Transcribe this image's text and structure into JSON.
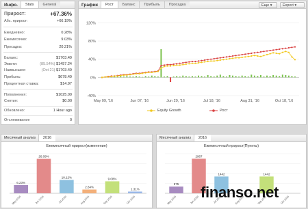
{
  "info": {
    "title": "Инфо.",
    "tabs": [
      "Stats",
      "General"
    ],
    "rows": [
      {
        "label": "Прирост:",
        "value": "+67.36%"
      },
      {
        "label": "Абс. прирост:",
        "value": "+66.19%"
      },
      {
        "label": "Ежедневно:",
        "value": "0.28%"
      },
      {
        "label": "Ежемесячно:",
        "value": "9.03%"
      },
      {
        "label": "Просадка:",
        "value": "20.21%"
      },
      {
        "label": "Баланс:",
        "value": "$1703.49"
      },
      {
        "label": "Эквити:",
        "value": "$1457.24",
        "note": "(85.54%)"
      },
      {
        "label": "Наивысшее:",
        "value": "$1703.49",
        "note": "(Oct 21)"
      },
      {
        "label": "Прибыль:",
        "value": "$678.49"
      },
      {
        "label": "Процентная ставка:",
        "value": "$14.97"
      },
      {
        "label": "Пополнения:",
        "value": "$1025.00"
      },
      {
        "label": "Снятия:",
        "value": "$0.00"
      },
      {
        "label": "Обновлено:",
        "value": "1 Hour ago"
      },
      {
        "label": "Отслеживание",
        "value": "0"
      }
    ]
  },
  "graph": {
    "title": "График",
    "tabs": [
      "Рост",
      "Баланс",
      "Прибыль",
      "Просадка"
    ],
    "dropdown": "Еще",
    "export": "Export",
    "yticks": [
      "120%",
      "80%",
      "40%",
      "0%",
      "-40%"
    ],
    "xticks": [
      "May 09, '16",
      "Jun 07, '16",
      "Jun 29, '16",
      "Jul 18, '16",
      "Aug 31, '16",
      "Oct 18, '16"
    ],
    "legend": [
      "Equity Growth",
      "Рост"
    ],
    "colors": {
      "growth": "#d94040",
      "equity": "#f2c81e",
      "bar_pos": "#7cc24f",
      "bar_neg": "#e04040"
    }
  },
  "chart_data": [
    {
      "type": "line",
      "ylim": [
        -40,
        140
      ],
      "series": [
        {
          "name": "Рост",
          "values": [
            0,
            1,
            2,
            3,
            3,
            4,
            5,
            6,
            6,
            7,
            8,
            9,
            9,
            10,
            11,
            12,
            12,
            13,
            14,
            26,
            27,
            28,
            28,
            29,
            30,
            31,
            32,
            33,
            34,
            35,
            35,
            36,
            37,
            38,
            39,
            40,
            41,
            42,
            43,
            44,
            45,
            46,
            47,
            48,
            49,
            50,
            51,
            52,
            53,
            54,
            55,
            56,
            57,
            58,
            59,
            60,
            61,
            62,
            63,
            64,
            65,
            66,
            67
          ]
        },
        {
          "name": "Equity Growth",
          "values": [
            0,
            1,
            1,
            2,
            3,
            3,
            4,
            5,
            5,
            6,
            7,
            8,
            8,
            9,
            10,
            11,
            11,
            12,
            13,
            20,
            24,
            25,
            25,
            26,
            27,
            27,
            28,
            29,
            30,
            31,
            31,
            32,
            33,
            34,
            35,
            36,
            36,
            37,
            38,
            39,
            40,
            41,
            42,
            43,
            43,
            44,
            45,
            46,
            47,
            48,
            47,
            46,
            48,
            50,
            52,
            54,
            53,
            52,
            55,
            57,
            55,
            45,
            39
          ]
        }
      ],
      "bars": [
        1,
        2,
        1,
        3,
        2,
        2,
        4,
        2,
        3,
        2,
        2,
        3,
        2,
        1,
        3,
        2,
        4,
        3,
        2,
        62,
        2,
        3,
        -10,
        2,
        3,
        2,
        4,
        3,
        2,
        3,
        2,
        4,
        3,
        2,
        5,
        3,
        2,
        4,
        6,
        3,
        2,
        5,
        4,
        3,
        2,
        4,
        3,
        2,
        6,
        4,
        3,
        5,
        2,
        4,
        3,
        5,
        4,
        3,
        6,
        5,
        4,
        3,
        2
      ]
    },
    {
      "type": "bar",
      "title": "Ежемесячный прирост(изменение)",
      "categories": [
        "May 2016",
        "Jun 2016",
        "Jul 2016",
        "Aug 2016",
        "Sep 2016",
        "Oct 2016"
      ],
      "values": [
        6.23,
        26.09,
        10.12,
        2.84,
        9.08,
        1.31
      ],
      "labels": [
        "6.23%",
        "26.09%",
        "10.12%",
        "2.84%",
        "9.08%",
        "1.31%"
      ],
      "colors": [
        "#a78bc0",
        "#e38a8a",
        "#8ec1e0",
        "#f3b07a",
        "#c3e07a",
        "#9ab8e8"
      ]
    },
    {
      "type": "bar",
      "title": "Ежемесячный прирост(Пункты)",
      "categories": [
        "May 2016",
        "Jun 2016",
        "Jul 2016",
        "Aug 2016",
        "Sep 2016",
        "Oct 2016"
      ],
      "values": [
        575,
        2967,
        1442,
        0,
        1442,
        0
      ],
      "labels": [
        "575",
        "2967",
        "1442",
        "",
        "1442",
        ""
      ],
      "colors": [
        "#a78bc0",
        "#e38a8a",
        "#8ec1e0",
        "#f3b07a",
        "#c3e07a",
        "#9ab8e8"
      ]
    }
  ],
  "monthly1": {
    "title": "Месячный анализ",
    "tab": "2016"
  },
  "monthly2": {
    "title": "Месячный анализ",
    "tab": "2016"
  },
  "watermark": "finanso.net"
}
